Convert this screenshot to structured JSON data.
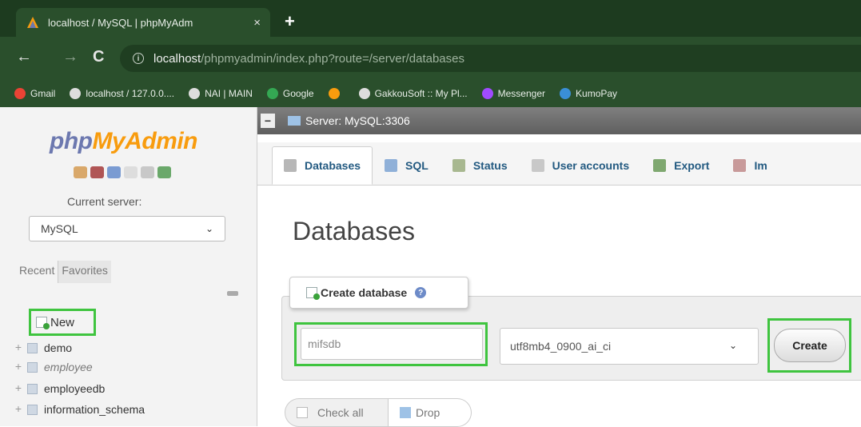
{
  "browser": {
    "tab_title": "localhost / MySQL | phpMyAdm",
    "tab_close": "×",
    "new_tab": "+",
    "back": "←",
    "forward": "→",
    "reload": "C",
    "url_info_icon": "i",
    "url_host": "localhost",
    "url_path": "/phpmyadmin/index.php?route=/server/databases",
    "bookmarks": [
      {
        "label": "Gmail",
        "color": "#ea4335"
      },
      {
        "label": "localhost / 127.0.0....",
        "color": "#dddddd"
      },
      {
        "label": "NAI | MAIN",
        "color": "#dddddd"
      },
      {
        "label": "Google",
        "color": "#34a853"
      },
      {
        "label": "",
        "color": "#f89c0e"
      },
      {
        "label": "GakkouSoft :: My Pl...",
        "color": "#dddddd"
      },
      {
        "label": "Messenger",
        "color": "#a04bff"
      },
      {
        "label": "KumoPay",
        "color": "#3a8fd6"
      }
    ]
  },
  "sidebar": {
    "logo_php": "php",
    "logo_myadmin": "MyAdmin",
    "current_server_label": "Current server:",
    "server_select": "MySQL",
    "recent_tab": "Recent",
    "favorites_tab": "Favorites",
    "new_item": "New",
    "databases": [
      "demo",
      "employee",
      "employeedb",
      "information_schema"
    ]
  },
  "server_bar": {
    "title": "Server: MySQL:3306",
    "collapse": "−"
  },
  "menu": {
    "tabs": [
      {
        "label": "Databases",
        "active": true,
        "icon_color": "#b7b7b7"
      },
      {
        "label": "SQL",
        "active": false,
        "icon_color": "#8fb0d8"
      },
      {
        "label": "Status",
        "active": false,
        "icon_color": "#a8b890"
      },
      {
        "label": "User accounts",
        "active": false,
        "icon_color": "#c8c8c8"
      },
      {
        "label": "Export",
        "active": false,
        "icon_color": "#7fa870"
      },
      {
        "label": "Im",
        "active": false,
        "icon_color": "#c89a9a"
      }
    ]
  },
  "main": {
    "page_title": "Databases",
    "create_legend": "Create database",
    "help_icon": "?",
    "db_name_value": "mifsdb",
    "collation_value": "utf8mb4_0900_ai_ci",
    "create_button": "Create",
    "check_all": "Check all",
    "drop": "Drop"
  },
  "colors": {
    "highlight": "#3fc43f",
    "link_blue": "#235a81",
    "browser_green": "#2a4f2c"
  }
}
